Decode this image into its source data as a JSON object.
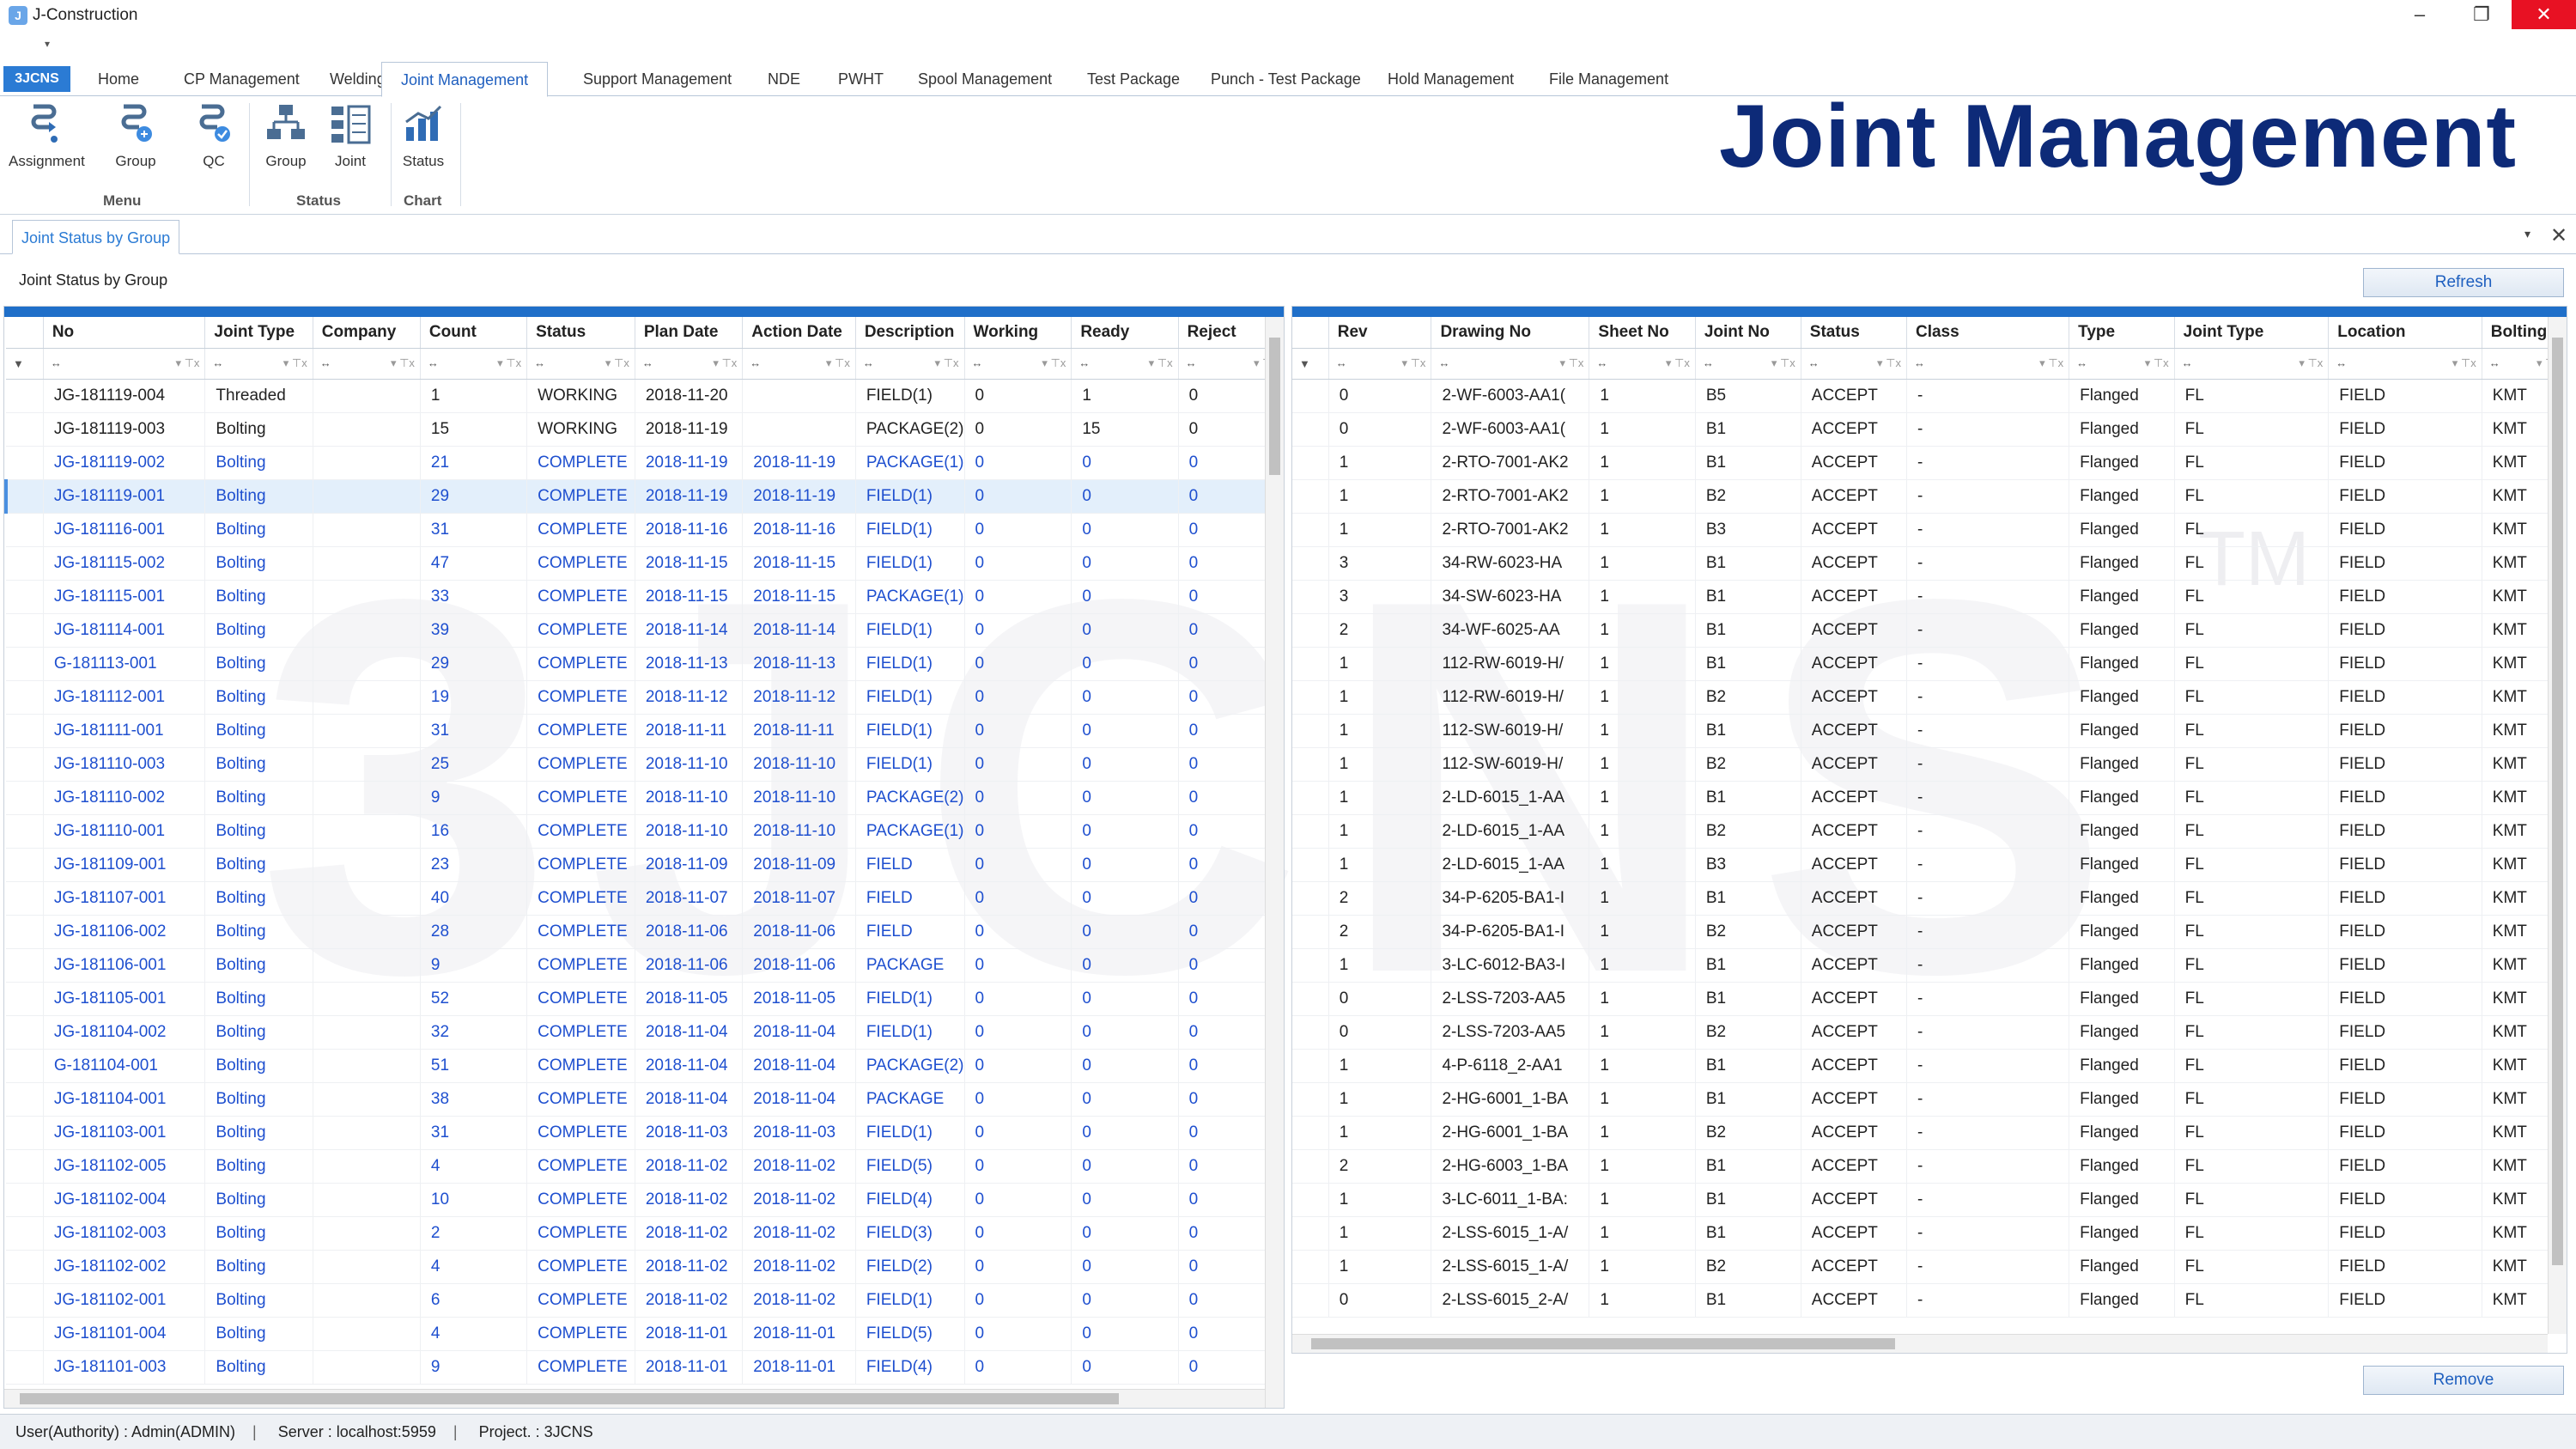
{
  "app": {
    "title": "J-Construction",
    "icon": "app-icon"
  },
  "window": {
    "minimize": "–",
    "maximize": "❐",
    "close": "✕"
  },
  "ribbon_tabs": {
    "app_tab": "3JCNS",
    "tabs": [
      "Home",
      "CP Management",
      "Welding",
      "Joint Management",
      "Support Management",
      "NDE",
      "PWHT",
      "Spool Management",
      "Test Package",
      "Punch - Test Package",
      "Hold Management",
      "File Management"
    ],
    "active": "Joint Management"
  },
  "ribbon": {
    "buttons": [
      {
        "label": "Assignment",
        "icon": "assignment-icon"
      },
      {
        "label": "Group",
        "icon": "group-icon"
      },
      {
        "label": "QC",
        "icon": "qc-icon"
      },
      {
        "label": "Group",
        "icon": "status-group-icon"
      },
      {
        "label": "Joint",
        "icon": "status-joint-icon"
      },
      {
        "label": "Status",
        "icon": "chart-status-icon"
      }
    ],
    "groups": [
      "Menu",
      "Status",
      "Chart"
    ]
  },
  "banner": "Joint Management",
  "doc_tab": "Joint Status by Group",
  "panel_label": "Joint Status by Group",
  "refresh_label": "Refresh",
  "remove_label": "Remove",
  "left_grid": {
    "columns": [
      "No",
      "Joint Type",
      "Company",
      "Count",
      "Status",
      "Plan Date",
      "Action Date",
      "Description",
      "Working",
      "Ready",
      "Reject"
    ],
    "rows": [
      [
        "JG-181119-004",
        "Threaded",
        "",
        "1",
        "WORKING",
        "2018-11-20",
        "",
        "FIELD(1)",
        "0",
        "1",
        "0"
      ],
      [
        "JG-181119-003",
        "Bolting",
        "",
        "15",
        "WORKING",
        "2018-11-19",
        "",
        "PACKAGE(2)",
        "0",
        "15",
        "0"
      ],
      [
        "JG-181119-002",
        "Bolting",
        "",
        "21",
        "COMPLETE",
        "2018-11-19",
        "2018-11-19",
        "PACKAGE(1)",
        "0",
        "0",
        "0"
      ],
      [
        "JG-181119-001",
        "Bolting",
        "",
        "29",
        "COMPLETE",
        "2018-11-19",
        "2018-11-19",
        "FIELD(1)",
        "0",
        "0",
        "0"
      ],
      [
        "JG-181116-001",
        "Bolting",
        "",
        "31",
        "COMPLETE",
        "2018-11-16",
        "2018-11-16",
        "FIELD(1)",
        "0",
        "0",
        "0"
      ],
      [
        "JG-181115-002",
        "Bolting",
        "",
        "47",
        "COMPLETE",
        "2018-11-15",
        "2018-11-15",
        "FIELD(1)",
        "0",
        "0",
        "0"
      ],
      [
        "JG-181115-001",
        "Bolting",
        "",
        "33",
        "COMPLETE",
        "2018-11-15",
        "2018-11-15",
        "PACKAGE(1)",
        "0",
        "0",
        "0"
      ],
      [
        "JG-181114-001",
        "Bolting",
        "",
        "39",
        "COMPLETE",
        "2018-11-14",
        "2018-11-14",
        "FIELD(1)",
        "0",
        "0",
        "0"
      ],
      [
        "G-181113-001",
        "Bolting",
        "",
        "29",
        "COMPLETE",
        "2018-11-13",
        "2018-11-13",
        "FIELD(1)",
        "0",
        "0",
        "0"
      ],
      [
        "JG-181112-001",
        "Bolting",
        "",
        "19",
        "COMPLETE",
        "2018-11-12",
        "2018-11-12",
        "FIELD(1)",
        "0",
        "0",
        "0"
      ],
      [
        "JG-181111-001",
        "Bolting",
        "",
        "31",
        "COMPLETE",
        "2018-11-11",
        "2018-11-11",
        "FIELD(1)",
        "0",
        "0",
        "0"
      ],
      [
        "JG-181110-003",
        "Bolting",
        "",
        "25",
        "COMPLETE",
        "2018-11-10",
        "2018-11-10",
        "FIELD(1)",
        "0",
        "0",
        "0"
      ],
      [
        "JG-181110-002",
        "Bolting",
        "",
        "9",
        "COMPLETE",
        "2018-11-10",
        "2018-11-10",
        "PACKAGE(2)",
        "0",
        "0",
        "0"
      ],
      [
        "JG-181110-001",
        "Bolting",
        "",
        "16",
        "COMPLETE",
        "2018-11-10",
        "2018-11-10",
        "PACKAGE(1)",
        "0",
        "0",
        "0"
      ],
      [
        "JG-181109-001",
        "Bolting",
        "",
        "23",
        "COMPLETE",
        "2018-11-09",
        "2018-11-09",
        "FIELD",
        "0",
        "0",
        "0"
      ],
      [
        "JG-181107-001",
        "Bolting",
        "",
        "40",
        "COMPLETE",
        "2018-11-07",
        "2018-11-07",
        "FIELD",
        "0",
        "0",
        "0"
      ],
      [
        "JG-181106-002",
        "Bolting",
        "",
        "28",
        "COMPLETE",
        "2018-11-06",
        "2018-11-06",
        "FIELD",
        "0",
        "0",
        "0"
      ],
      [
        "JG-181106-001",
        "Bolting",
        "",
        "9",
        "COMPLETE",
        "2018-11-06",
        "2018-11-06",
        "PACKAGE",
        "0",
        "0",
        "0"
      ],
      [
        "JG-181105-001",
        "Bolting",
        "",
        "52",
        "COMPLETE",
        "2018-11-05",
        "2018-11-05",
        "FIELD(1)",
        "0",
        "0",
        "0"
      ],
      [
        "JG-181104-002",
        "Bolting",
        "",
        "32",
        "COMPLETE",
        "2018-11-04",
        "2018-11-04",
        "FIELD(1)",
        "0",
        "0",
        "0"
      ],
      [
        "G-181104-001",
        "Bolting",
        "",
        "51",
        "COMPLETE",
        "2018-11-04",
        "2018-11-04",
        "PACKAGE(2)",
        "0",
        "0",
        "0"
      ],
      [
        "JG-181104-001",
        "Bolting",
        "",
        "38",
        "COMPLETE",
        "2018-11-04",
        "2018-11-04",
        "PACKAGE",
        "0",
        "0",
        "0"
      ],
      [
        "JG-181103-001",
        "Bolting",
        "",
        "31",
        "COMPLETE",
        "2018-11-03",
        "2018-11-03",
        "FIELD(1)",
        "0",
        "0",
        "0"
      ],
      [
        "JG-181102-005",
        "Bolting",
        "",
        "4",
        "COMPLETE",
        "2018-11-02",
        "2018-11-02",
        "FIELD(5)",
        "0",
        "0",
        "0"
      ],
      [
        "JG-181102-004",
        "Bolting",
        "",
        "10",
        "COMPLETE",
        "2018-11-02",
        "2018-11-02",
        "FIELD(4)",
        "0",
        "0",
        "0"
      ],
      [
        "JG-181102-003",
        "Bolting",
        "",
        "2",
        "COMPLETE",
        "2018-11-02",
        "2018-11-02",
        "FIELD(3)",
        "0",
        "0",
        "0"
      ],
      [
        "JG-181102-002",
        "Bolting",
        "",
        "4",
        "COMPLETE",
        "2018-11-02",
        "2018-11-02",
        "FIELD(2)",
        "0",
        "0",
        "0"
      ],
      [
        "JG-181102-001",
        "Bolting",
        "",
        "6",
        "COMPLETE",
        "2018-11-02",
        "2018-11-02",
        "FIELD(1)",
        "0",
        "0",
        "0"
      ],
      [
        "JG-181101-004",
        "Bolting",
        "",
        "4",
        "COMPLETE",
        "2018-11-01",
        "2018-11-01",
        "FIELD(5)",
        "0",
        "0",
        "0"
      ],
      [
        "JG-181101-003",
        "Bolting",
        "",
        "9",
        "COMPLETE",
        "2018-11-01",
        "2018-11-01",
        "FIELD(4)",
        "0",
        "0",
        "0"
      ]
    ]
  },
  "right_grid": {
    "columns": [
      "Rev",
      "Drawing No",
      "Sheet No",
      "Joint No",
      "Status",
      "Class",
      "Type",
      "Joint Type",
      "Location",
      "Bolting"
    ],
    "rows": [
      [
        "0",
        "2-WF-6003-AA1(",
        "1",
        "B5",
        "ACCEPT",
        "-",
        "Flanged",
        "FL",
        "FIELD",
        "KMT"
      ],
      [
        "0",
        "2-WF-6003-AA1(",
        "1",
        "B1",
        "ACCEPT",
        "-",
        "Flanged",
        "FL",
        "FIELD",
        "KMT"
      ],
      [
        "1",
        "2-RTO-7001-AK2",
        "1",
        "B1",
        "ACCEPT",
        "-",
        "Flanged",
        "FL",
        "FIELD",
        "KMT"
      ],
      [
        "1",
        "2-RTO-7001-AK2",
        "1",
        "B2",
        "ACCEPT",
        "-",
        "Flanged",
        "FL",
        "FIELD",
        "KMT"
      ],
      [
        "1",
        "2-RTO-7001-AK2",
        "1",
        "B3",
        "ACCEPT",
        "-",
        "Flanged",
        "FL",
        "FIELD",
        "KMT"
      ],
      [
        "3",
        "34-RW-6023-HA",
        "1",
        "B1",
        "ACCEPT",
        "-",
        "Flanged",
        "FL",
        "FIELD",
        "KMT"
      ],
      [
        "3",
        "34-SW-6023-HA",
        "1",
        "B1",
        "ACCEPT",
        "-",
        "Flanged",
        "FL",
        "FIELD",
        "KMT"
      ],
      [
        "2",
        "34-WF-6025-AA",
        "1",
        "B1",
        "ACCEPT",
        "-",
        "Flanged",
        "FL",
        "FIELD",
        "KMT"
      ],
      [
        "1",
        "112-RW-6019-H/",
        "1",
        "B1",
        "ACCEPT",
        "-",
        "Flanged",
        "FL",
        "FIELD",
        "KMT"
      ],
      [
        "1",
        "112-RW-6019-H/",
        "1",
        "B2",
        "ACCEPT",
        "-",
        "Flanged",
        "FL",
        "FIELD",
        "KMT"
      ],
      [
        "1",
        "112-SW-6019-H/",
        "1",
        "B1",
        "ACCEPT",
        "-",
        "Flanged",
        "FL",
        "FIELD",
        "KMT"
      ],
      [
        "1",
        "112-SW-6019-H/",
        "1",
        "B2",
        "ACCEPT",
        "-",
        "Flanged",
        "FL",
        "FIELD",
        "KMT"
      ],
      [
        "1",
        "2-LD-6015_1-AA",
        "1",
        "B1",
        "ACCEPT",
        "-",
        "Flanged",
        "FL",
        "FIELD",
        "KMT"
      ],
      [
        "1",
        "2-LD-6015_1-AA",
        "1",
        "B2",
        "ACCEPT",
        "-",
        "Flanged",
        "FL",
        "FIELD",
        "KMT"
      ],
      [
        "1",
        "2-LD-6015_1-AA",
        "1",
        "B3",
        "ACCEPT",
        "-",
        "Flanged",
        "FL",
        "FIELD",
        "KMT"
      ],
      [
        "2",
        "34-P-6205-BA1-I",
        "1",
        "B1",
        "ACCEPT",
        "-",
        "Flanged",
        "FL",
        "FIELD",
        "KMT"
      ],
      [
        "2",
        "34-P-6205-BA1-I",
        "1",
        "B2",
        "ACCEPT",
        "-",
        "Flanged",
        "FL",
        "FIELD",
        "KMT"
      ],
      [
        "1",
        "3-LC-6012-BA3-I",
        "1",
        "B1",
        "ACCEPT",
        "-",
        "Flanged",
        "FL",
        "FIELD",
        "KMT"
      ],
      [
        "0",
        "2-LSS-7203-AA5",
        "1",
        "B1",
        "ACCEPT",
        "-",
        "Flanged",
        "FL",
        "FIELD",
        "KMT"
      ],
      [
        "0",
        "2-LSS-7203-AA5",
        "1",
        "B2",
        "ACCEPT",
        "-",
        "Flanged",
        "FL",
        "FIELD",
        "KMT"
      ],
      [
        "1",
        "4-P-6118_2-AA1",
        "1",
        "B1",
        "ACCEPT",
        "-",
        "Flanged",
        "FL",
        "FIELD",
        "KMT"
      ],
      [
        "1",
        "2-HG-6001_1-BA",
        "1",
        "B1",
        "ACCEPT",
        "-",
        "Flanged",
        "FL",
        "FIELD",
        "KMT"
      ],
      [
        "1",
        "2-HG-6001_1-BA",
        "1",
        "B2",
        "ACCEPT",
        "-",
        "Flanged",
        "FL",
        "FIELD",
        "KMT"
      ],
      [
        "2",
        "2-HG-6003_1-BA",
        "1",
        "B1",
        "ACCEPT",
        "-",
        "Flanged",
        "FL",
        "FIELD",
        "KMT"
      ],
      [
        "1",
        "3-LC-6011_1-BA:",
        "1",
        "B1",
        "ACCEPT",
        "-",
        "Flanged",
        "FL",
        "FIELD",
        "KMT"
      ],
      [
        "1",
        "2-LSS-6015_1-A/",
        "1",
        "B1",
        "ACCEPT",
        "-",
        "Flanged",
        "FL",
        "FIELD",
        "KMT"
      ],
      [
        "1",
        "2-LSS-6015_1-A/",
        "1",
        "B2",
        "ACCEPT",
        "-",
        "Flanged",
        "FL",
        "FIELD",
        "KMT"
      ],
      [
        "0",
        "2-LSS-6015_2-A/",
        "1",
        "B1",
        "ACCEPT",
        "-",
        "Flanged",
        "FL",
        "FIELD",
        "KMT"
      ]
    ]
  },
  "statusbar": {
    "user": "User(Authority) : Admin(ADMIN)",
    "server": "Server : localhost:5959",
    "project": "Project. : 3JCNS"
  },
  "colors": {
    "accent": "#1f6fc9",
    "link": "#1e4fcf",
    "banner": "#0d2a78",
    "close": "#e81123"
  }
}
